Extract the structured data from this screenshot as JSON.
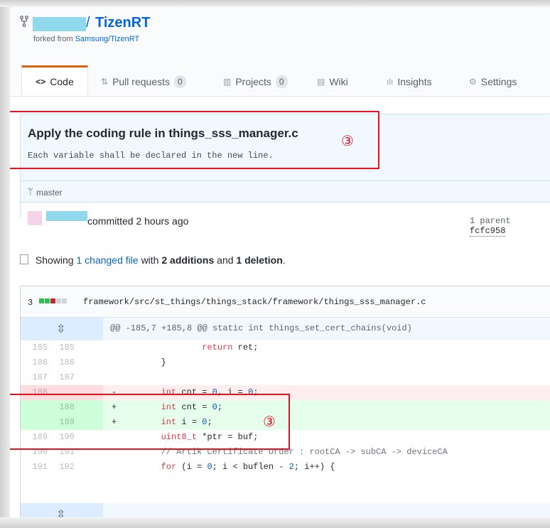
{
  "repo": {
    "name": "TizenRT",
    "slash": "/",
    "forked_from_prefix": "forked from",
    "forked_from_link": "Samsung/TizenRT"
  },
  "tabs": [
    {
      "label": "Code",
      "icon": "code-icon",
      "counter": null,
      "selected": true,
      "glyph": "<>"
    },
    {
      "label": "Pull requests",
      "icon": "pull-request-icon",
      "counter": "0",
      "glyph": "⇅"
    },
    {
      "label": "Projects",
      "icon": "project-icon",
      "counter": "0",
      "glyph": "▥"
    },
    {
      "label": "Wiki",
      "icon": "book-icon",
      "counter": null,
      "glyph": "▤"
    },
    {
      "label": "Insights",
      "icon": "graph-icon",
      "counter": null,
      "glyph": "ılı"
    },
    {
      "label": "Settings",
      "icon": "gear-icon",
      "counter": null,
      "glyph": "⚙"
    }
  ],
  "commit": {
    "title": "Apply the coding rule in things_sss_manager.c",
    "description": "Each variable shall be declared in the new line.",
    "branch": "master",
    "committed_text": "committed 2 hours ago",
    "parent_label": "1 parent",
    "parent_sha": "fcfc958"
  },
  "toc": {
    "showing": "Showing",
    "changed": "1 changed file",
    "with": "with",
    "additions": "2 additions",
    "and": "and",
    "deletions": "1 deletion",
    "end": "."
  },
  "file": {
    "diffstat_count": "3",
    "path": "framework/src/st_things/things_stack/framework/things_sss_manager.c",
    "hunk_header": "@@ -185,7 +185,8 @@ static int things_set_cert_chains(void)",
    "lines": [
      {
        "old": "185",
        "new": "185",
        "type": "ctx",
        "sign": "",
        "code": "                return ret;"
      },
      {
        "old": "186",
        "new": "186",
        "type": "ctx",
        "sign": "",
        "code": "        }"
      },
      {
        "old": "187",
        "new": "187",
        "type": "ctx",
        "sign": "",
        "code": ""
      },
      {
        "old": "188",
        "new": "",
        "type": "del",
        "sign": "-",
        "code": "        int cnt = 0, i = 0;"
      },
      {
        "old": "",
        "new": "188",
        "type": "add",
        "sign": "+",
        "code": "        int cnt = 0;"
      },
      {
        "old": "",
        "new": "189",
        "type": "add",
        "sign": "+",
        "code": "        int i = 0;"
      },
      {
        "old": "189",
        "new": "190",
        "type": "ctx",
        "sign": "",
        "code": "        uint8_t *ptr = buf;"
      },
      {
        "old": "190",
        "new": "191",
        "type": "ctx",
        "sign": "",
        "code": "        // Artik Certificate Order : rootCA -> subCA -> deviceCA"
      },
      {
        "old": "191",
        "new": "192",
        "type": "ctx",
        "sign": "",
        "code": "        for (i = 0; i < buflen - 2; i++) {"
      }
    ]
  },
  "annotations": {
    "marker": "③"
  },
  "colors": {
    "accent_orange": "#e36209",
    "link_blue": "#0366d6",
    "annotation_red": "#e8121c",
    "add_bg": "#e6ffed",
    "add_gutter": "#cdffd8",
    "del_bg": "#ffeef0",
    "del_gutter": "#ffdce0"
  }
}
